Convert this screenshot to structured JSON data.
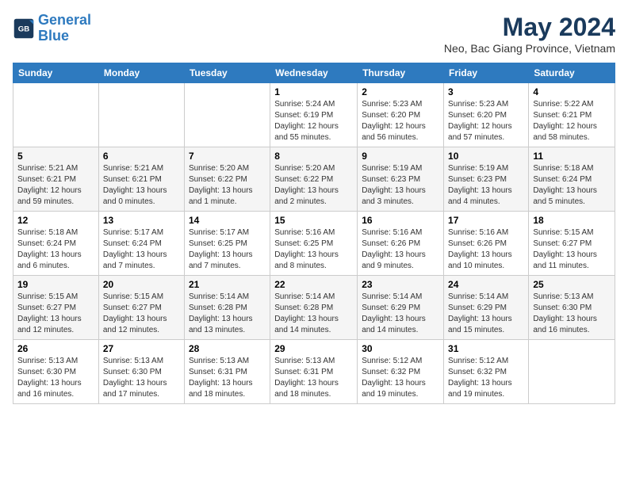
{
  "logo": {
    "text1": "General",
    "text2": "Blue"
  },
  "title": "May 2024",
  "location": "Neo, Bac Giang Province, Vietnam",
  "days_of_week": [
    "Sunday",
    "Monday",
    "Tuesday",
    "Wednesday",
    "Thursday",
    "Friday",
    "Saturday"
  ],
  "weeks": [
    [
      {
        "day": "",
        "info": ""
      },
      {
        "day": "",
        "info": ""
      },
      {
        "day": "",
        "info": ""
      },
      {
        "day": "1",
        "info": "Sunrise: 5:24 AM\nSunset: 6:19 PM\nDaylight: 12 hours\nand 55 minutes."
      },
      {
        "day": "2",
        "info": "Sunrise: 5:23 AM\nSunset: 6:20 PM\nDaylight: 12 hours\nand 56 minutes."
      },
      {
        "day": "3",
        "info": "Sunrise: 5:23 AM\nSunset: 6:20 PM\nDaylight: 12 hours\nand 57 minutes."
      },
      {
        "day": "4",
        "info": "Sunrise: 5:22 AM\nSunset: 6:21 PM\nDaylight: 12 hours\nand 58 minutes."
      }
    ],
    [
      {
        "day": "5",
        "info": "Sunrise: 5:21 AM\nSunset: 6:21 PM\nDaylight: 12 hours\nand 59 minutes."
      },
      {
        "day": "6",
        "info": "Sunrise: 5:21 AM\nSunset: 6:21 PM\nDaylight: 13 hours\nand 0 minutes."
      },
      {
        "day": "7",
        "info": "Sunrise: 5:20 AM\nSunset: 6:22 PM\nDaylight: 13 hours\nand 1 minute."
      },
      {
        "day": "8",
        "info": "Sunrise: 5:20 AM\nSunset: 6:22 PM\nDaylight: 13 hours\nand 2 minutes."
      },
      {
        "day": "9",
        "info": "Sunrise: 5:19 AM\nSunset: 6:23 PM\nDaylight: 13 hours\nand 3 minutes."
      },
      {
        "day": "10",
        "info": "Sunrise: 5:19 AM\nSunset: 6:23 PM\nDaylight: 13 hours\nand 4 minutes."
      },
      {
        "day": "11",
        "info": "Sunrise: 5:18 AM\nSunset: 6:24 PM\nDaylight: 13 hours\nand 5 minutes."
      }
    ],
    [
      {
        "day": "12",
        "info": "Sunrise: 5:18 AM\nSunset: 6:24 PM\nDaylight: 13 hours\nand 6 minutes."
      },
      {
        "day": "13",
        "info": "Sunrise: 5:17 AM\nSunset: 6:24 PM\nDaylight: 13 hours\nand 7 minutes."
      },
      {
        "day": "14",
        "info": "Sunrise: 5:17 AM\nSunset: 6:25 PM\nDaylight: 13 hours\nand 7 minutes."
      },
      {
        "day": "15",
        "info": "Sunrise: 5:16 AM\nSunset: 6:25 PM\nDaylight: 13 hours\nand 8 minutes."
      },
      {
        "day": "16",
        "info": "Sunrise: 5:16 AM\nSunset: 6:26 PM\nDaylight: 13 hours\nand 9 minutes."
      },
      {
        "day": "17",
        "info": "Sunrise: 5:16 AM\nSunset: 6:26 PM\nDaylight: 13 hours\nand 10 minutes."
      },
      {
        "day": "18",
        "info": "Sunrise: 5:15 AM\nSunset: 6:27 PM\nDaylight: 13 hours\nand 11 minutes."
      }
    ],
    [
      {
        "day": "19",
        "info": "Sunrise: 5:15 AM\nSunset: 6:27 PM\nDaylight: 13 hours\nand 12 minutes."
      },
      {
        "day": "20",
        "info": "Sunrise: 5:15 AM\nSunset: 6:27 PM\nDaylight: 13 hours\nand 12 minutes."
      },
      {
        "day": "21",
        "info": "Sunrise: 5:14 AM\nSunset: 6:28 PM\nDaylight: 13 hours\nand 13 minutes."
      },
      {
        "day": "22",
        "info": "Sunrise: 5:14 AM\nSunset: 6:28 PM\nDaylight: 13 hours\nand 14 minutes."
      },
      {
        "day": "23",
        "info": "Sunrise: 5:14 AM\nSunset: 6:29 PM\nDaylight: 13 hours\nand 14 minutes."
      },
      {
        "day": "24",
        "info": "Sunrise: 5:14 AM\nSunset: 6:29 PM\nDaylight: 13 hours\nand 15 minutes."
      },
      {
        "day": "25",
        "info": "Sunrise: 5:13 AM\nSunset: 6:30 PM\nDaylight: 13 hours\nand 16 minutes."
      }
    ],
    [
      {
        "day": "26",
        "info": "Sunrise: 5:13 AM\nSunset: 6:30 PM\nDaylight: 13 hours\nand 16 minutes."
      },
      {
        "day": "27",
        "info": "Sunrise: 5:13 AM\nSunset: 6:30 PM\nDaylight: 13 hours\nand 17 minutes."
      },
      {
        "day": "28",
        "info": "Sunrise: 5:13 AM\nSunset: 6:31 PM\nDaylight: 13 hours\nand 18 minutes."
      },
      {
        "day": "29",
        "info": "Sunrise: 5:13 AM\nSunset: 6:31 PM\nDaylight: 13 hours\nand 18 minutes."
      },
      {
        "day": "30",
        "info": "Sunrise: 5:12 AM\nSunset: 6:32 PM\nDaylight: 13 hours\nand 19 minutes."
      },
      {
        "day": "31",
        "info": "Sunrise: 5:12 AM\nSunset: 6:32 PM\nDaylight: 13 hours\nand 19 minutes."
      },
      {
        "day": "",
        "info": ""
      }
    ]
  ]
}
